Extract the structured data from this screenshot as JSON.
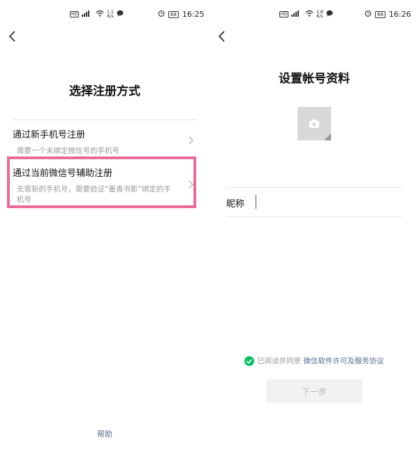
{
  "left": {
    "status": {
      "hd": "HD",
      "signal": "⁴⁶",
      "net_speed_value": "1.1",
      "net_speed_unit": "K/s",
      "battery": "68",
      "time": "16:25"
    },
    "title": "选择注册方式",
    "options": [
      {
        "title": "通过新手机号注册",
        "desc": "需要一个未绑定微信号的手机号"
      },
      {
        "title": "通过当前微信号辅助注册",
        "desc_line1": "无需新的手机号，需要验证“墨香书影”绑定的手",
        "desc_line2": "机号"
      }
    ],
    "help": "帮助"
  },
  "right": {
    "status": {
      "hd": "HD",
      "signal": "⁴⁶",
      "net_speed_value": "2.8",
      "net_speed_unit": "K/s",
      "battery": "68",
      "time": "16:26"
    },
    "title": "设置帐号资料",
    "nickname_label": "昵称",
    "nickname_value": "",
    "agree_text": "已阅读并同意",
    "agree_link": "微信软件许可及服务协议",
    "next_button": "下一步"
  },
  "colors": {
    "highlight_border": "#ec6a9a",
    "link": "#576b95",
    "check_green": "#07c160"
  }
}
